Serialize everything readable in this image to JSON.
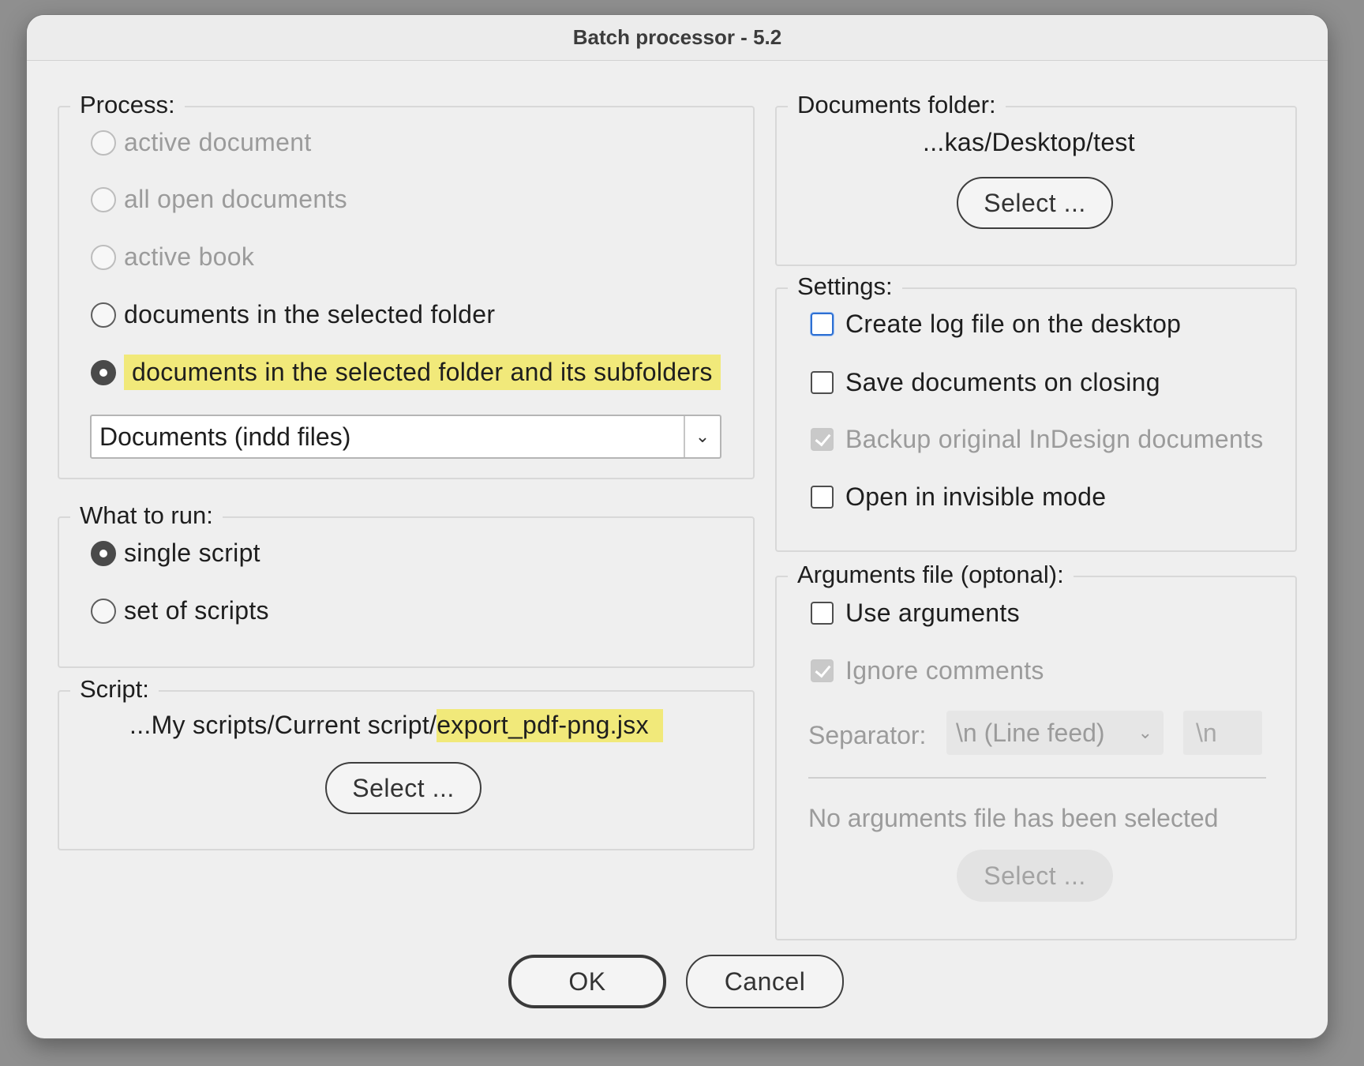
{
  "window": {
    "title": "Batch processor - 5.2"
  },
  "process": {
    "legend": "Process:",
    "options": [
      {
        "label": "active document",
        "enabled": false,
        "selected": false
      },
      {
        "label": "all open documents",
        "enabled": false,
        "selected": false
      },
      {
        "label": "active book",
        "enabled": false,
        "selected": false
      },
      {
        "label": "documents in the selected folder",
        "enabled": true,
        "selected": false
      },
      {
        "label": "documents in the selected folder and its subfolders",
        "enabled": true,
        "selected": true
      }
    ],
    "file_type": {
      "value": "Documents (indd files)"
    }
  },
  "what_to_run": {
    "legend": "What to run:",
    "options": [
      {
        "label": "single script",
        "selected": true
      },
      {
        "label": "set of scripts",
        "selected": false
      }
    ]
  },
  "script": {
    "legend": "Script:",
    "path_prefix": "...My scripts/Current script/",
    "path_file": "export_pdf-png.jsx",
    "select_label": "Select ..."
  },
  "documents_folder": {
    "legend": "Documents folder:",
    "path": "...kas/Desktop/test",
    "select_label": "Select ..."
  },
  "settings": {
    "legend": "Settings:",
    "options": [
      {
        "label": "Create log file on the desktop",
        "checked": false,
        "enabled": true
      },
      {
        "label": "Save documents on closing",
        "checked": false,
        "enabled": true
      },
      {
        "label": "Backup original InDesign documents",
        "checked": true,
        "enabled": false
      },
      {
        "label": "Open in invisible mode",
        "checked": false,
        "enabled": true
      }
    ]
  },
  "arguments": {
    "legend": "Arguments file (optonal):",
    "use_arguments": "Use arguments",
    "ignore_comments": "Ignore comments",
    "separator_label": "Separator:",
    "separator_value": "\\n (Line feed)",
    "separator_field": "\\n",
    "status": "No arguments file has been selected",
    "select_label": "Select ..."
  },
  "buttons": {
    "ok": "OK",
    "cancel": "Cancel"
  }
}
